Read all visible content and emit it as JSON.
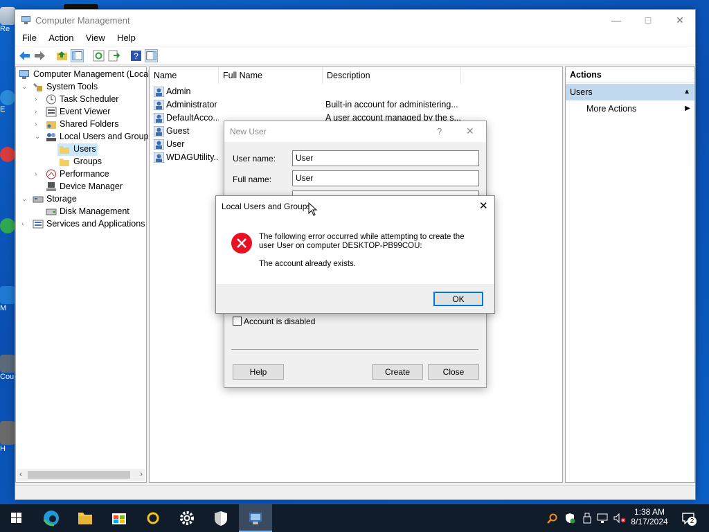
{
  "window": {
    "title": "Computer Management",
    "menu": [
      "File",
      "Action",
      "View",
      "Help"
    ]
  },
  "tree": {
    "root": "Computer Management (Local",
    "system_tools": "System Tools",
    "task_scheduler": "Task Scheduler",
    "event_viewer": "Event Viewer",
    "shared_folders": "Shared Folders",
    "local_users_groups": "Local Users and Groups",
    "users": "Users",
    "groups": "Groups",
    "performance": "Performance",
    "device_manager": "Device Manager",
    "storage": "Storage",
    "disk_management": "Disk Management",
    "services_apps": "Services and Applications"
  },
  "list": {
    "columns": [
      "Name",
      "Full Name",
      "Description"
    ],
    "rows": [
      {
        "name": "Admin",
        "description": ""
      },
      {
        "name": "Administrator",
        "description": "Built-in account for administering..."
      },
      {
        "name": "DefaultAcco...",
        "description": "A user account managed by the s..."
      },
      {
        "name": "Guest",
        "description": ""
      },
      {
        "name": "User",
        "description": ""
      },
      {
        "name": "WDAGUtility...",
        "description": ""
      }
    ]
  },
  "actions": {
    "header": "Actions",
    "section": "Users",
    "more": "More Actions"
  },
  "new_user": {
    "title": "New User",
    "help_glyph": "?",
    "username_label": "User name:",
    "username_value": "User",
    "fullname_label": "Full name:",
    "fullname_value": "User",
    "account_disabled": "Account is disabled",
    "help_btn": "Help",
    "create_btn": "Create",
    "close_btn": "Close"
  },
  "error_dialog": {
    "title": "Local Users and Groups",
    "message": "The following error occurred while attempting to create the user User on computer DESKTOP-PB99COU:",
    "detail": "The account already exists.",
    "ok": "OK"
  },
  "desktop_labels": [
    "Re",
    "E",
    "M",
    "Cou",
    "H"
  ],
  "taskbar": {
    "time": "1:38 AM",
    "date": "8/17/2024",
    "notifications": "2"
  },
  "colors": {
    "accent": "#0078d7",
    "error": "#e81123",
    "selection": "#cfe6f8"
  }
}
